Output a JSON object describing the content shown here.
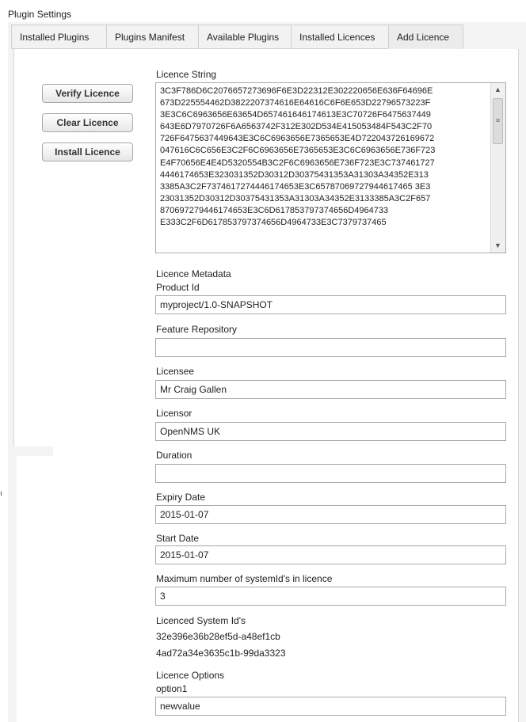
{
  "window": {
    "title": "Plugin Settings"
  },
  "tabs": [
    {
      "label": "Installed Plugins",
      "active": false
    },
    {
      "label": "Plugins Manifest",
      "active": false
    },
    {
      "label": "Available Plugins",
      "active": false
    },
    {
      "label": "Installed Licences",
      "active": false
    },
    {
      "label": "Add Licence",
      "active": true
    }
  ],
  "actions": {
    "verify_label": "Verify Licence",
    "clear_label": "Clear Licence",
    "install_label": "Install Licence"
  },
  "licence_string": {
    "label": "Licence String",
    "lines": [
      "3C3F786D6C2076657273696F6E3D22312E302220656E636F64696E",
      "673D225554462D3822207374616E64616C6F6E653D22796573223F",
      "3E3C6C6963656E63654D657461646174613E3C70726F6475637449",
      "643E6D7970726F6A6563742F312E302D534E415053484F543C2F70",
      "726F6475637449643E3C6C6963656E7365653E4D722043726169672",
      "047616C6C656E3C2F6C6963656E7365653E3C6C6963656E736F723",
      "E4F70656E4E4D5320554B3C2F6C6963656E736F723E3C737461727",
      "4446174653E323031352D30312D30375431353A31303A34352E313",
      "3385A3C2F7374617274446174653E3C65787069727944617465 3E3",
      "23031352D30312D30375431353A31303A34352E3133385A3C2F657",
      "870697279446174653E3C6D617853797374656D4964733",
      "E333C2F6D617853797374656D4964733E3C7379737465"
    ],
    "scroll_up_icon": "triangle-up-icon",
    "scroll_down_icon": "triangle-down-icon"
  },
  "metadata": {
    "section_label": "Licence Metadata",
    "product_id": {
      "label": "Product Id",
      "value": "myproject/1.0-SNAPSHOT"
    },
    "feature_repository": {
      "label": "Feature Repository",
      "value": ""
    },
    "licensee": {
      "label": "Licensee",
      "value": "Mr Craig Gallen"
    },
    "licensor": {
      "label": "Licensor",
      "value": "OpenNMS UK"
    },
    "duration": {
      "label": "Duration",
      "value": ""
    },
    "expiry_date": {
      "label": "Expiry Date",
      "value": "2015-01-07"
    },
    "start_date": {
      "label": "Start Date",
      "value": "2015-01-07"
    },
    "max_system_ids": {
      "label": "Maximum number of systemId's in licence",
      "value": "3"
    },
    "system_ids": {
      "label": "Licenced System Id's",
      "values": [
        "32e396e36b28ef5d-a48ef1cb",
        "4ad72a34e3635c1b-99da3323"
      ]
    },
    "options": {
      "label": "Licence Options",
      "option_name": "option1",
      "option_value": "newvalue"
    }
  },
  "edge_glyph": "ı"
}
